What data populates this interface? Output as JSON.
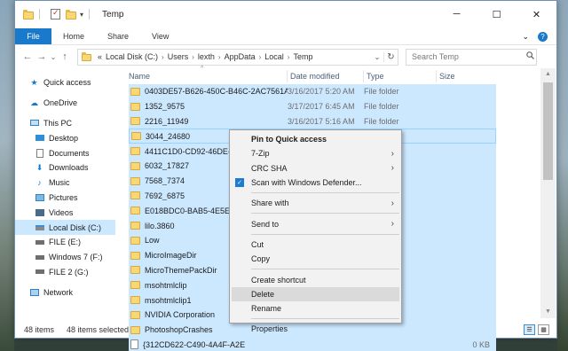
{
  "window": {
    "title": "Temp",
    "controls": {
      "minimize": "─",
      "maximize": "☐",
      "close": "✕"
    }
  },
  "ribbon": {
    "tabs": [
      "File",
      "Home",
      "Share",
      "View"
    ],
    "expand_glyph": "⌄",
    "help_glyph": "?"
  },
  "address": {
    "back": "←",
    "forward": "→",
    "recent": "⌄",
    "up": "↑",
    "overflow": "«",
    "crumbs": [
      "Local Disk (C:)",
      "Users",
      "lexth",
      "AppData",
      "Local",
      "Temp"
    ],
    "separator": "›",
    "dropdown": "⌄",
    "refresh": "↻"
  },
  "search": {
    "placeholder": "Search Temp",
    "icon": "search-icon"
  },
  "navpane": {
    "quick_access": "Quick access",
    "onedrive": "OneDrive",
    "this_pc": "This PC",
    "pc_items": [
      "Desktop",
      "Documents",
      "Downloads",
      "Music",
      "Pictures",
      "Videos",
      "Local Disk (C:)",
      "FILE (E:)",
      "Windows 7 (F:)",
      "FILE 2 (G:)"
    ],
    "network": "Network"
  },
  "columns": {
    "name": "Name",
    "date": "Date modified",
    "type": "Type",
    "size": "Size",
    "sort_glyph": "^"
  },
  "files": [
    {
      "name": "0403DE57-B626-450C-B46C-2AC7561A1D...",
      "date": "3/16/2017 5:20 AM",
      "type": "File folder",
      "size": ""
    },
    {
      "name": "1352_9575",
      "date": "3/17/2017 6:45 AM",
      "type": "File folder",
      "size": ""
    },
    {
      "name": "2216_11949",
      "date": "3/16/2017 5:16 AM",
      "type": "File folder",
      "size": ""
    },
    {
      "name": "3044_24680",
      "date": "",
      "type": "",
      "size": ""
    },
    {
      "name": "4411C1D0-CD92-46DE-B51F",
      "date": "",
      "type": "",
      "size": ""
    },
    {
      "name": "6032_17827",
      "date": "",
      "type": "",
      "size": ""
    },
    {
      "name": "7568_7374",
      "date": "",
      "type": "",
      "size": ""
    },
    {
      "name": "7692_6875",
      "date": "",
      "type": "",
      "size": ""
    },
    {
      "name": "E018BDC0-BAB5-4E5E-8922",
      "date": "",
      "type": "",
      "size": ""
    },
    {
      "name": "lilo.3860",
      "date": "",
      "type": "",
      "size": ""
    },
    {
      "name": "Low",
      "date": "",
      "type": "",
      "size": ""
    },
    {
      "name": "MicroImageDir",
      "date": "",
      "type": "",
      "size": ""
    },
    {
      "name": "MicroThemePackDir",
      "date": "",
      "type": "",
      "size": ""
    },
    {
      "name": "msohtmlclip",
      "date": "",
      "type": "",
      "size": ""
    },
    {
      "name": "msohtmlclip1",
      "date": "",
      "type": "",
      "size": ""
    },
    {
      "name": "NVIDIA Corporation",
      "date": "",
      "type": "",
      "size": ""
    },
    {
      "name": "PhotoshopCrashes",
      "date": "",
      "type": "",
      "size": ""
    },
    {
      "name": "{312CD622-C490-4A4F-A2E",
      "date": "",
      "type": "",
      "size": "0 KB"
    }
  ],
  "context_menu": [
    {
      "label": "Pin to Quick access",
      "bold": true
    },
    {
      "label": "7-Zip",
      "submenu": true
    },
    {
      "label": "CRC SHA",
      "submenu": true
    },
    {
      "label": "Scan with Windows Defender...",
      "icon": "defender-icon"
    },
    {
      "sep": true
    },
    {
      "label": "Share with",
      "submenu": true
    },
    {
      "sep": true
    },
    {
      "label": "Send to",
      "submenu": true
    },
    {
      "sep": true
    },
    {
      "label": "Cut"
    },
    {
      "label": "Copy"
    },
    {
      "sep": true
    },
    {
      "label": "Create shortcut"
    },
    {
      "label": "Delete",
      "hover": true
    },
    {
      "label": "Rename"
    },
    {
      "sep": true
    },
    {
      "label": "Properties"
    }
  ],
  "status": {
    "count": "48 items",
    "selected": "48 items selected"
  },
  "colors": {
    "accent": "#1979ca",
    "selection": "#cce8ff",
    "folder": "#f8d775"
  }
}
